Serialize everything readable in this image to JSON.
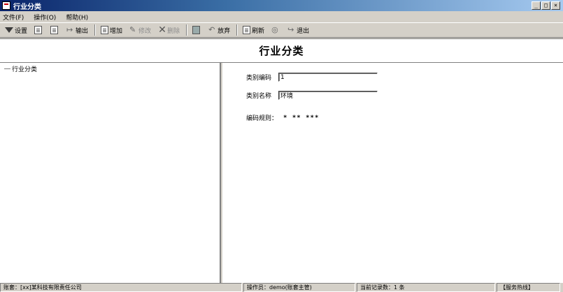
{
  "window": {
    "title": "行业分类"
  },
  "menu": [
    {
      "label": "文件(F)"
    },
    {
      "label": "操作(O)"
    },
    {
      "label": "帮助(H)"
    }
  ],
  "toolbar": {
    "setup": "设置",
    "output": "输出",
    "add": "增加",
    "modify": "修改",
    "delete": "删除",
    "discard": "放弃",
    "refresh": "刷新",
    "exit": "退出"
  },
  "page": {
    "heading": "行业分类"
  },
  "tree": {
    "root": "行业分类"
  },
  "form": {
    "code_label": "类别编码",
    "code_value": "1",
    "name_label": "类别名称",
    "name_value": "环境",
    "rule_label": "编码规则：",
    "rule_value": "* ** ***"
  },
  "status": {
    "account": "账套：[xx]某科技有限责任公司",
    "operator": "操作员：demo(账套主管)",
    "records": "当前记录数：1 条",
    "support": "【服务热线】"
  }
}
